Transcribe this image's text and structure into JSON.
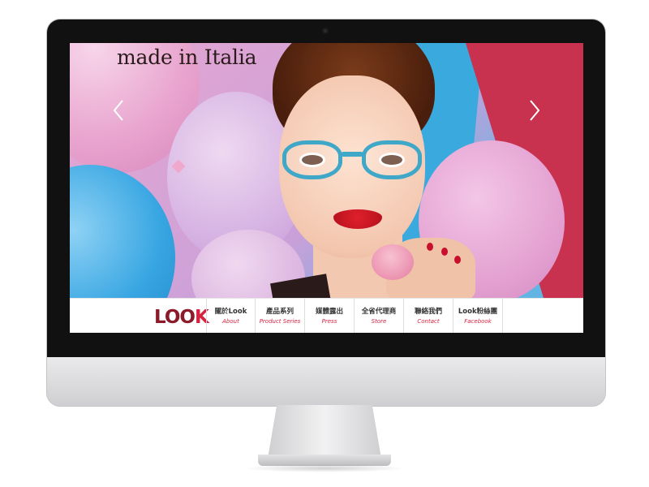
{
  "hero": {
    "tagline": "made in Italia",
    "prev_arrow_icon": "chevron-left-icon",
    "next_arrow_icon": "chevron-right-icon"
  },
  "brand": {
    "logo_main": "LOO",
    "logo_accent": "K",
    "logo_color": "#8b1a2a",
    "accent_color": "#d6213f"
  },
  "nav": {
    "items": [
      {
        "zh": "關於Look",
        "en": "About"
      },
      {
        "zh": "產品系列",
        "en": "Product Series"
      },
      {
        "zh": "媒體露出",
        "en": "Press"
      },
      {
        "zh": "全省代理商",
        "en": "Store"
      },
      {
        "zh": "聯絡我們",
        "en": "Contact"
      },
      {
        "zh": "Look粉絲團",
        "en": "Facebook"
      }
    ]
  }
}
